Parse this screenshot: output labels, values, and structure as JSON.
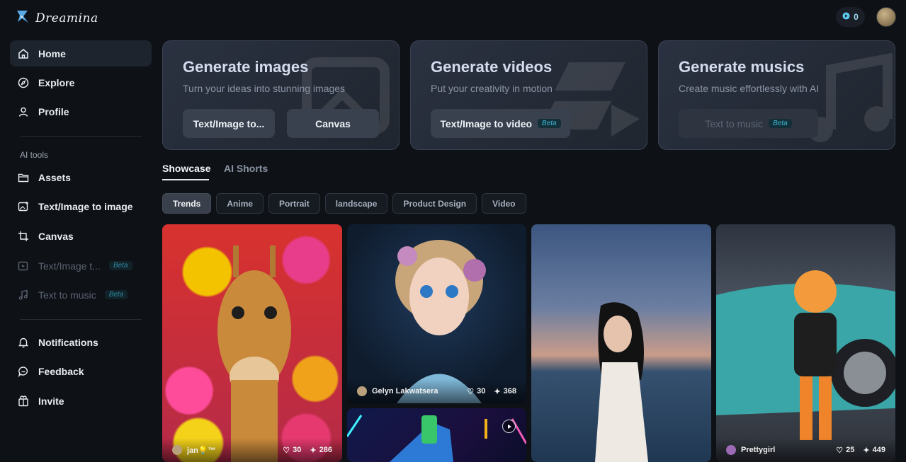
{
  "app": {
    "brand": "Dreamina"
  },
  "header": {
    "credits": "0"
  },
  "sidebar": {
    "main": [
      {
        "label": "Home"
      },
      {
        "label": "Explore"
      },
      {
        "label": "Profile"
      }
    ],
    "section_label": "AI tools",
    "tools": [
      {
        "label": "Assets"
      },
      {
        "label": "Text/Image to image"
      },
      {
        "label": "Canvas"
      },
      {
        "label": "Text/Image t...",
        "badge": "Beta"
      },
      {
        "label": "Text to music",
        "badge": "Beta"
      }
    ],
    "bottom": [
      {
        "label": "Notifications"
      },
      {
        "label": "Feedback"
      },
      {
        "label": "Invite"
      }
    ]
  },
  "cards": [
    {
      "title": "Generate images",
      "subtitle": "Turn your ideas into stunning images",
      "buttons": [
        "Text/Image to...",
        "Canvas"
      ]
    },
    {
      "title": "Generate videos",
      "subtitle": "Put your creativity in motion",
      "buttons": [
        "Text/Image to video"
      ],
      "badge": "Beta"
    },
    {
      "title": "Generate musics",
      "subtitle": "Create music effortlessly with AI",
      "buttons": [
        "Text to music"
      ],
      "badge": "Beta"
    }
  ],
  "tabs": [
    "Showcase",
    "AI Shorts"
  ],
  "chips": [
    "Trends",
    "Anime",
    "Portrait",
    "landscape",
    "Product Design",
    "Video"
  ],
  "gallery": [
    {
      "author": "jan💡™",
      "likes": "30",
      "uses": "286"
    },
    {
      "author": "Gelyn Lakwatsera",
      "likes": "30",
      "uses": "368"
    },
    {
      "author": "Prettygirl",
      "likes": "25",
      "uses": "449"
    }
  ]
}
